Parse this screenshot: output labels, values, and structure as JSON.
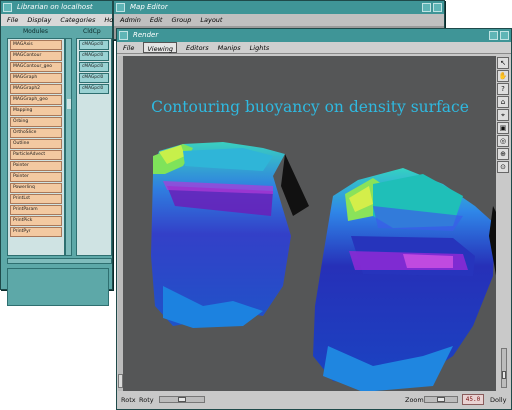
{
  "librarian": {
    "title": "Librarian on localhost",
    "menu": [
      "File",
      "Display",
      "Categories",
      "Hosts"
    ],
    "modules_header": "Modules",
    "categories_header": "CldCp",
    "modules": [
      "MAGAxis",
      "MAGContour",
      "MAGContour_geo",
      "MAGGraph",
      "MAGGraph2",
      "MAGGraph_geo",
      "Mapping",
      "Orbing",
      "OrthoSlice",
      "Outline",
      "ParticleAdvect",
      "Pointer",
      "Pointer",
      "Powerlinq",
      "PrintLst",
      "PrintParam",
      "PrintPick",
      "PrintPyr"
    ],
    "categories": [
      "cMAGpcl0",
      "cMAGpcl0",
      "cMAGpcl0",
      "cMAGpcl0",
      "cMAGpcl0"
    ]
  },
  "map_editor": {
    "title": "Map Editor",
    "menu": [
      "Admin",
      "Edit",
      "Group",
      "Layout"
    ]
  },
  "render": {
    "title": "Render",
    "menu": [
      "File",
      "Viewing",
      "Editors",
      "Manips",
      "Lights"
    ],
    "active_menu": "Viewing",
    "scene_title": "Contouring buoyancy on density surface",
    "rotx_label": "Rotx",
    "roty_label": "Roty",
    "zoom_label": "Zoom",
    "zoom_value": "45.0",
    "dolly_label": "Dolly",
    "tools": [
      "↖",
      "✋",
      "?",
      "⌂",
      "⌖",
      "▣",
      "◎",
      "⊕",
      "⊙"
    ]
  },
  "colors": {
    "titlebar": "#3f9597",
    "title_text": "#2fb9e0",
    "viewport_bg": "#555657",
    "module_item": "#f3c9a1"
  }
}
